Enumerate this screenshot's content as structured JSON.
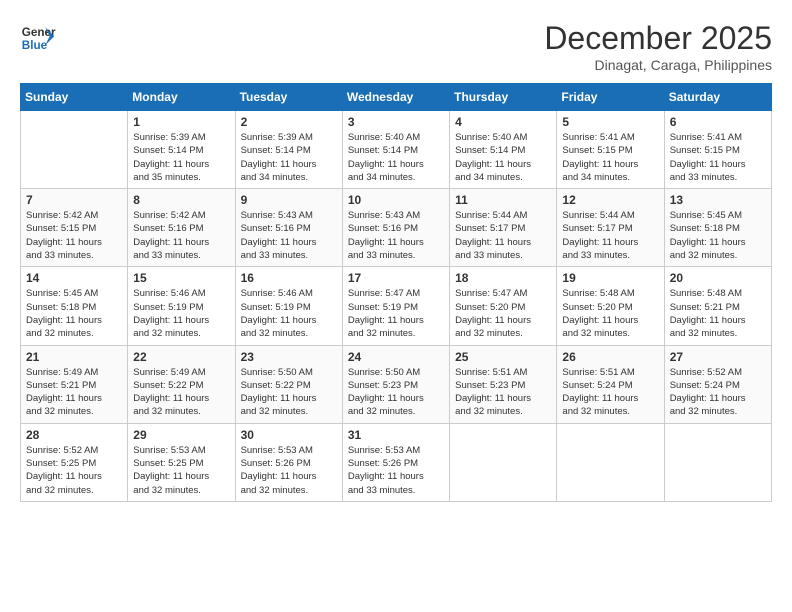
{
  "header": {
    "logo_line1": "General",
    "logo_line2": "Blue",
    "month_title": "December 2025",
    "subtitle": "Dinagat, Caraga, Philippines"
  },
  "days_of_week": [
    "Sunday",
    "Monday",
    "Tuesday",
    "Wednesday",
    "Thursday",
    "Friday",
    "Saturday"
  ],
  "weeks": [
    [
      {
        "day": "",
        "info": ""
      },
      {
        "day": "1",
        "info": "Sunrise: 5:39 AM\nSunset: 5:14 PM\nDaylight: 11 hours\nand 35 minutes."
      },
      {
        "day": "2",
        "info": "Sunrise: 5:39 AM\nSunset: 5:14 PM\nDaylight: 11 hours\nand 34 minutes."
      },
      {
        "day": "3",
        "info": "Sunrise: 5:40 AM\nSunset: 5:14 PM\nDaylight: 11 hours\nand 34 minutes."
      },
      {
        "day": "4",
        "info": "Sunrise: 5:40 AM\nSunset: 5:14 PM\nDaylight: 11 hours\nand 34 minutes."
      },
      {
        "day": "5",
        "info": "Sunrise: 5:41 AM\nSunset: 5:15 PM\nDaylight: 11 hours\nand 34 minutes."
      },
      {
        "day": "6",
        "info": "Sunrise: 5:41 AM\nSunset: 5:15 PM\nDaylight: 11 hours\nand 33 minutes."
      }
    ],
    [
      {
        "day": "7",
        "info": "Sunrise: 5:42 AM\nSunset: 5:15 PM\nDaylight: 11 hours\nand 33 minutes."
      },
      {
        "day": "8",
        "info": "Sunrise: 5:42 AM\nSunset: 5:16 PM\nDaylight: 11 hours\nand 33 minutes."
      },
      {
        "day": "9",
        "info": "Sunrise: 5:43 AM\nSunset: 5:16 PM\nDaylight: 11 hours\nand 33 minutes."
      },
      {
        "day": "10",
        "info": "Sunrise: 5:43 AM\nSunset: 5:16 PM\nDaylight: 11 hours\nand 33 minutes."
      },
      {
        "day": "11",
        "info": "Sunrise: 5:44 AM\nSunset: 5:17 PM\nDaylight: 11 hours\nand 33 minutes."
      },
      {
        "day": "12",
        "info": "Sunrise: 5:44 AM\nSunset: 5:17 PM\nDaylight: 11 hours\nand 33 minutes."
      },
      {
        "day": "13",
        "info": "Sunrise: 5:45 AM\nSunset: 5:18 PM\nDaylight: 11 hours\nand 32 minutes."
      }
    ],
    [
      {
        "day": "14",
        "info": "Sunrise: 5:45 AM\nSunset: 5:18 PM\nDaylight: 11 hours\nand 32 minutes."
      },
      {
        "day": "15",
        "info": "Sunrise: 5:46 AM\nSunset: 5:19 PM\nDaylight: 11 hours\nand 32 minutes."
      },
      {
        "day": "16",
        "info": "Sunrise: 5:46 AM\nSunset: 5:19 PM\nDaylight: 11 hours\nand 32 minutes."
      },
      {
        "day": "17",
        "info": "Sunrise: 5:47 AM\nSunset: 5:19 PM\nDaylight: 11 hours\nand 32 minutes."
      },
      {
        "day": "18",
        "info": "Sunrise: 5:47 AM\nSunset: 5:20 PM\nDaylight: 11 hours\nand 32 minutes."
      },
      {
        "day": "19",
        "info": "Sunrise: 5:48 AM\nSunset: 5:20 PM\nDaylight: 11 hours\nand 32 minutes."
      },
      {
        "day": "20",
        "info": "Sunrise: 5:48 AM\nSunset: 5:21 PM\nDaylight: 11 hours\nand 32 minutes."
      }
    ],
    [
      {
        "day": "21",
        "info": "Sunrise: 5:49 AM\nSunset: 5:21 PM\nDaylight: 11 hours\nand 32 minutes."
      },
      {
        "day": "22",
        "info": "Sunrise: 5:49 AM\nSunset: 5:22 PM\nDaylight: 11 hours\nand 32 minutes."
      },
      {
        "day": "23",
        "info": "Sunrise: 5:50 AM\nSunset: 5:22 PM\nDaylight: 11 hours\nand 32 minutes."
      },
      {
        "day": "24",
        "info": "Sunrise: 5:50 AM\nSunset: 5:23 PM\nDaylight: 11 hours\nand 32 minutes."
      },
      {
        "day": "25",
        "info": "Sunrise: 5:51 AM\nSunset: 5:23 PM\nDaylight: 11 hours\nand 32 minutes."
      },
      {
        "day": "26",
        "info": "Sunrise: 5:51 AM\nSunset: 5:24 PM\nDaylight: 11 hours\nand 32 minutes."
      },
      {
        "day": "27",
        "info": "Sunrise: 5:52 AM\nSunset: 5:24 PM\nDaylight: 11 hours\nand 32 minutes."
      }
    ],
    [
      {
        "day": "28",
        "info": "Sunrise: 5:52 AM\nSunset: 5:25 PM\nDaylight: 11 hours\nand 32 minutes."
      },
      {
        "day": "29",
        "info": "Sunrise: 5:53 AM\nSunset: 5:25 PM\nDaylight: 11 hours\nand 32 minutes."
      },
      {
        "day": "30",
        "info": "Sunrise: 5:53 AM\nSunset: 5:26 PM\nDaylight: 11 hours\nand 32 minutes."
      },
      {
        "day": "31",
        "info": "Sunrise: 5:53 AM\nSunset: 5:26 PM\nDaylight: 11 hours\nand 33 minutes."
      },
      {
        "day": "",
        "info": ""
      },
      {
        "day": "",
        "info": ""
      },
      {
        "day": "",
        "info": ""
      }
    ]
  ]
}
